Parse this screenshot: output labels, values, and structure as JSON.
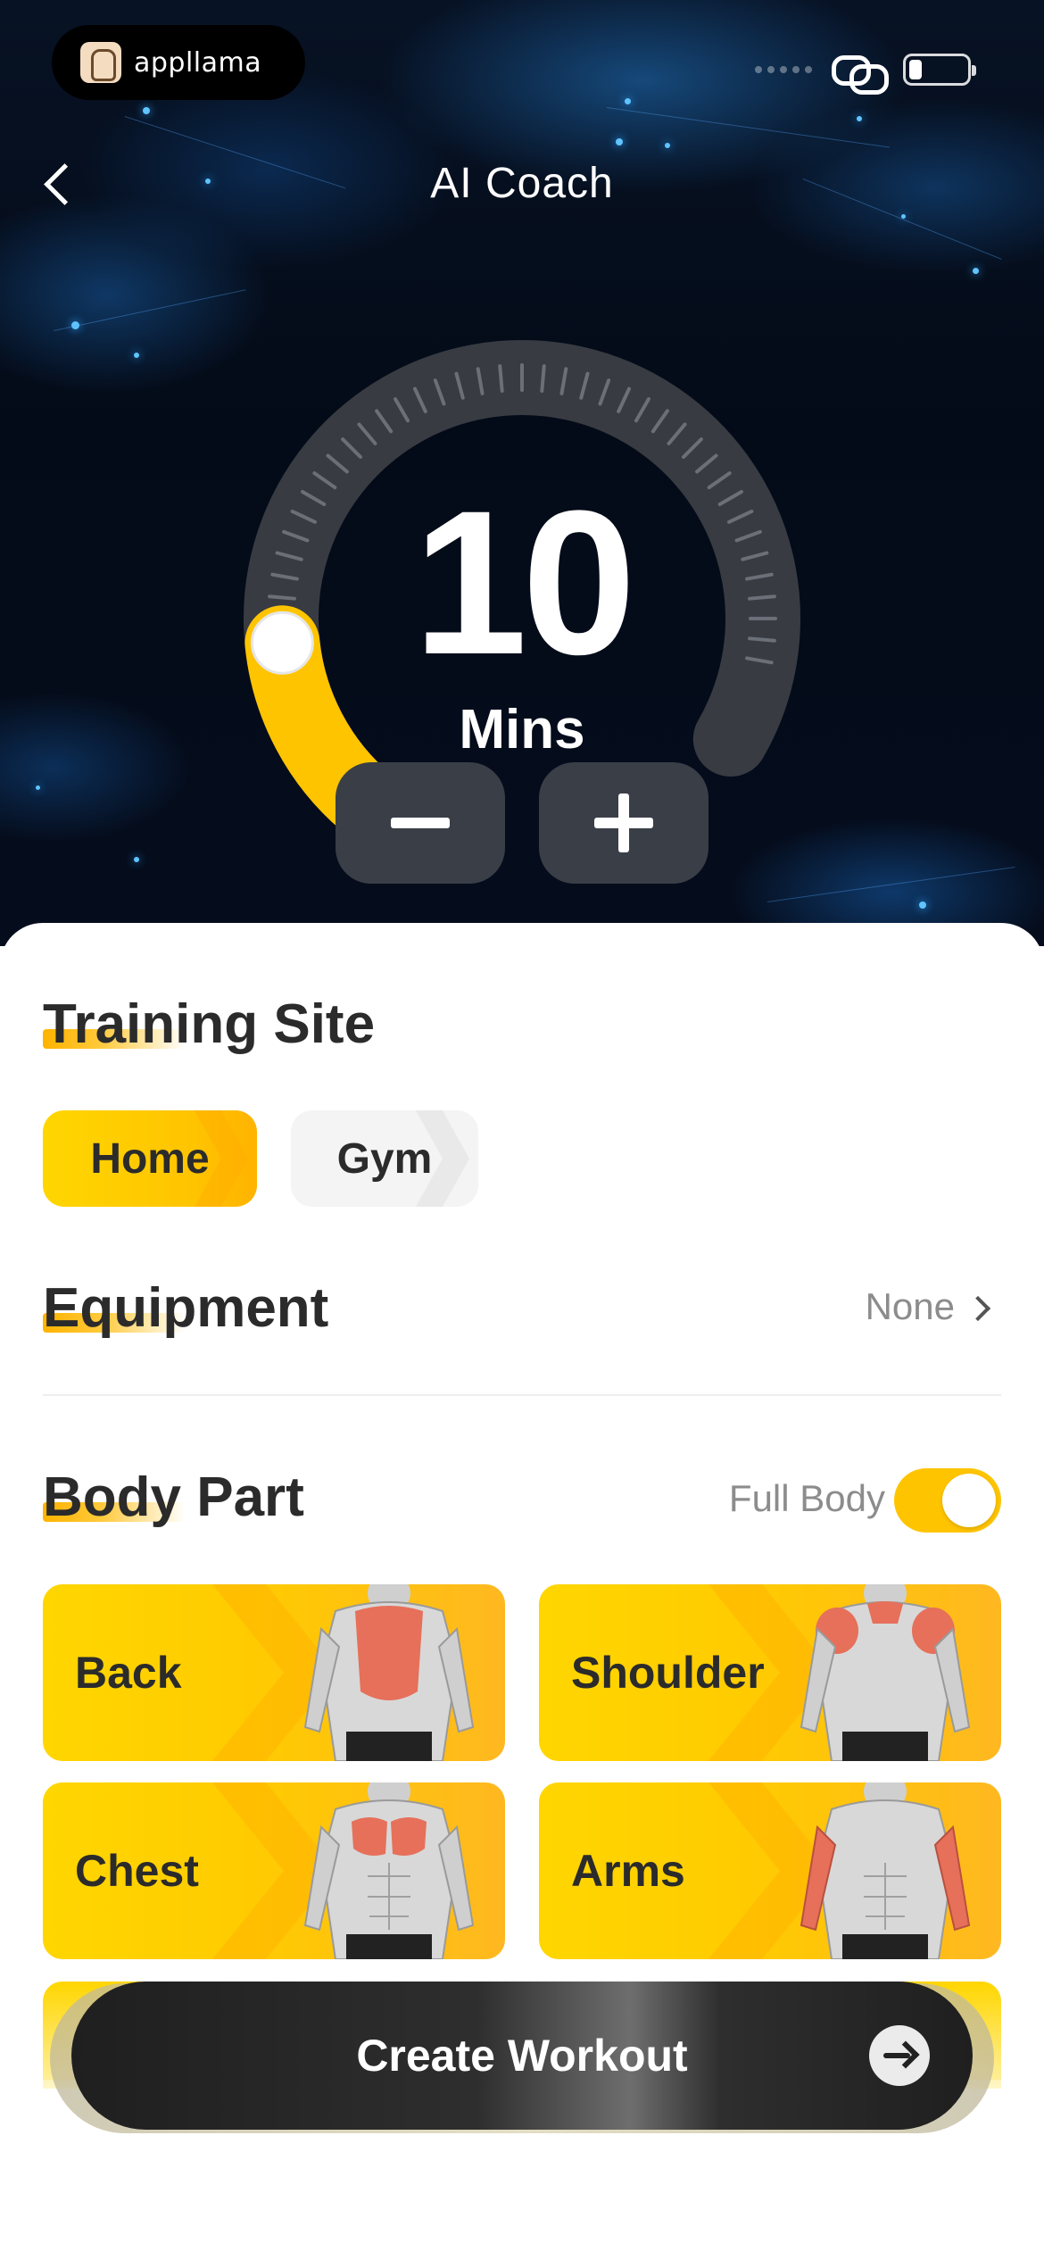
{
  "status_bar": {
    "brand_name": "appllama",
    "brand_icon": "llama-logo-icon",
    "connection_icon": "link-icon",
    "battery_icon": "battery-icon"
  },
  "header": {
    "title": "AI Coach",
    "back_icon": "chevron-left-icon"
  },
  "duration": {
    "value": "10",
    "unit": "Mins",
    "fraction_of_max": 0.17,
    "accent_color": "#FFC400",
    "minus_icon": "minus-icon",
    "plus_icon": "plus-icon"
  },
  "training_site": {
    "title": "Training Site",
    "options": [
      {
        "label": "Home",
        "selected": true
      },
      {
        "label": "Gym",
        "selected": false
      }
    ]
  },
  "equipment": {
    "title": "Equipment",
    "value": "None"
  },
  "body_part": {
    "title": "Body Part",
    "full_body_label": "Full Body",
    "full_body_on": true,
    "parts": [
      {
        "label": "Back",
        "highlight": "back"
      },
      {
        "label": "Shoulder",
        "highlight": "shoulders"
      },
      {
        "label": "Chest",
        "highlight": "chest"
      },
      {
        "label": "Arms",
        "highlight": "arms"
      }
    ]
  },
  "cta": {
    "label": "Create Workout",
    "icon": "arrow-right-icon"
  }
}
